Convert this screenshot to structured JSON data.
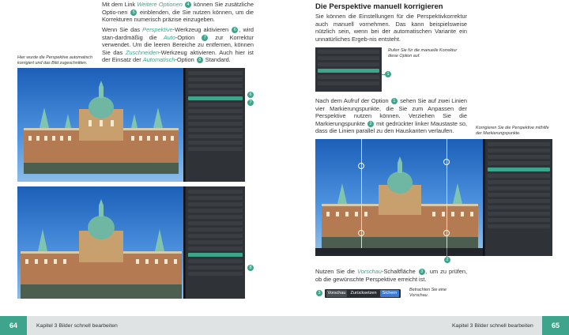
{
  "left_page": {
    "para1": {
      "t1": "Mit dem Link ",
      "link": "Weitere Optionen",
      "b1": "4",
      "t2": " können Sie zusätzliche Optio-nen ",
      "b2": "5",
      "t3": " einblenden, die Sie nutzen können, um die Korrekturen numerisch präzise einzugeben."
    },
    "para2": {
      "t1": "Wenn Sie das ",
      "tool": "Perspektive",
      "t2": "-Werkzeug aktivieren ",
      "b1": "6",
      "t3": ", wird stan-dardmäßig die ",
      "auto": "Auto",
      "t4": "-Option ",
      "b2": "7",
      "t5": " zur Korrektur verwendet. Um die leeren Bereiche zu entfernen, können Sie das ",
      "zuschneiden": "Zuschneiden",
      "t6": "-Werkzeug aktivieren. Auch hier ist der Einsatz der ",
      "automatisch": "Automatisch",
      "t7": "-Option ",
      "b3": "8",
      "t8": " Standard."
    },
    "caption": "Hier wurde die Perspektive automatisch korrigiert und das Bild zugeschnitten.",
    "callouts": [
      "6",
      "7",
      "8"
    ],
    "page_number": "64",
    "chapter": "Kapitel 3   Bilder schnell bearbeiten"
  },
  "right_page": {
    "heading": "Die Perspektive manuell korrigieren",
    "intro": "Sie können die Einstellungen für die Perspektivkorrektur auch manuell vornehmen. Das kann beispielsweise nützlich sein, wenn bei der automatischen Variante ein unnatürliches Ergeb-nis entsteht.",
    "caption1": "Rufen Sie für die manuelle Korrektur diese Option auf.",
    "callout1": "1",
    "para2": {
      "t1": "Nach dem Aufruf der Option ",
      "b1": "1",
      "t2": " sehen Sie auf zwei Linien vier Markierungspunkte, die Sie zum Anpassen der Perspektive nutzen können. Verziehen Sie die Markierungspunkte ",
      "b2": "2",
      "t3": " mit gedrückter linker Maustaste so, dass die Linien parallel zu den Hauskanten verlaufen."
    },
    "caption2": "Korrigieren Sie die Perspektive mithilfe der Markierungspunkte.",
    "callout2": "2",
    "para3": {
      "t1": "Nutzen Sie die ",
      "vorschau": "Vorschau",
      "t2": "-Schaltfläche ",
      "b1": "3",
      "t3": ", um zu prüfen, ob die gewünschte Perspektive erreicht ist."
    },
    "buttons": {
      "vorschau": "Vorschau",
      "zuruecksetzen": "Zurücksetzen",
      "sichern": "Sichern"
    },
    "callout3": "3",
    "caption3": "Betrachten Sie eine Vorschau.",
    "page_number": "65",
    "chapter": "Kapitel 3   Bilder schnell bearbeiten"
  },
  "colors": {
    "accent": "#3ea58c",
    "panel": "#2f3236",
    "footer_gray": "#dfe3e3"
  }
}
